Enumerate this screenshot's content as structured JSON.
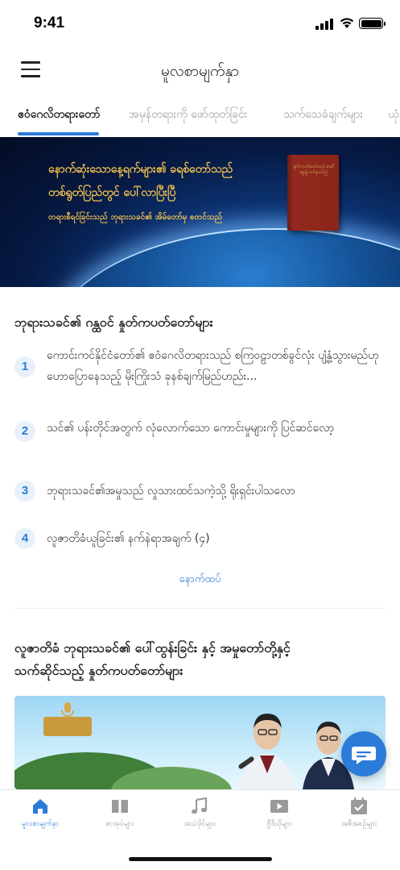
{
  "status_bar": {
    "time": "9:41"
  },
  "header": {
    "title": "မူလစာမျက်နှာ"
  },
  "tabs": [
    {
      "label": "ဧဝံဂေလိတရားတော်",
      "active": true
    },
    {
      "label": "အမှန်တရားကို ဖော်ထုတ်ခြင်း",
      "active": false
    },
    {
      "label": "သက်သေခံချက်များ",
      "active": false
    },
    {
      "label": "ယုံ",
      "active": false
    }
  ],
  "banner": {
    "line1": "နောက်ဆုံးသောနေ့ရက်များ၏ ခရစ်တော်သည်",
    "line2": "တစ်ရွတ်ပြည်တွင် ပေါ်လာပြီးပြီ",
    "line3": "တရားစီရင်ခြင်းသည် ဘုရားသခင်၏ အိမ်တော်မှ စတင်သည်",
    "book_title": "နှုတ်ကပတ်တော်သည် ဇာတိခန္ဓာ၌ ထင်ရှားသည်"
  },
  "section1": {
    "title": "ဘုရားသခင်၏ ဂန္ထဝင် နှုတ်ကပတ်တော်များ",
    "items": [
      {
        "num": "1",
        "text": "ကောင်းကင်နိုင်ငံတော်၏ ဧဝံဂေလိတရားသည် စကြဝဠာတစ်ခွင်လုံး ပျံ့နှံ့သွားမည်ဟု ဟောပြောနေသည့် မိုးကြိုးသံ ခုနစ်ချက်မြည်ဟည်း..."
      },
      {
        "num": "2",
        "text": "သင်၏ ပန်းတိုင်အတွက် လုံလောက်သော ကောင်းမှုများကို ပြင်ဆင်လော့"
      },
      {
        "num": "3",
        "text": "ဘုရားသခင်၏အမှုသည် လှုသားထင်သကဲ့သို့ ရိုးရှင်းပါသလော"
      },
      {
        "num": "4",
        "text": "လူဇာတိခံယူခြင်း၏ နက်နဲရာအချက် (၄)"
      }
    ],
    "more_label": "နောက်ထပ်"
  },
  "section2": {
    "title_line1": "လူဇာတိခံ ဘုရားသခင်၏ ပေါ်ထွန်းခြင်း နှင့် အမှုတော်တို့နှင့်",
    "title_line2": "သက်ဆိုင်သည့် နှုတ်ကပတ်တော်များ"
  },
  "bottom_nav": [
    {
      "label": "မူလစာမျက်နှာ",
      "icon": "home-icon",
      "active": true
    },
    {
      "label": "စာအုပ်များ",
      "icon": "book-icon",
      "active": false
    },
    {
      "label": "အသံဖိုင်များ",
      "icon": "music-icon",
      "active": false
    },
    {
      "label": "ဗွီဒီယိုများ",
      "icon": "video-icon",
      "active": false
    },
    {
      "label": "အစီအစဉ်များ",
      "icon": "calendar-check-icon",
      "active": false
    }
  ],
  "colors": {
    "accent": "#2b7cd8",
    "banner_text": "#f3c24e",
    "badge_bg": "#e8f1fb"
  }
}
